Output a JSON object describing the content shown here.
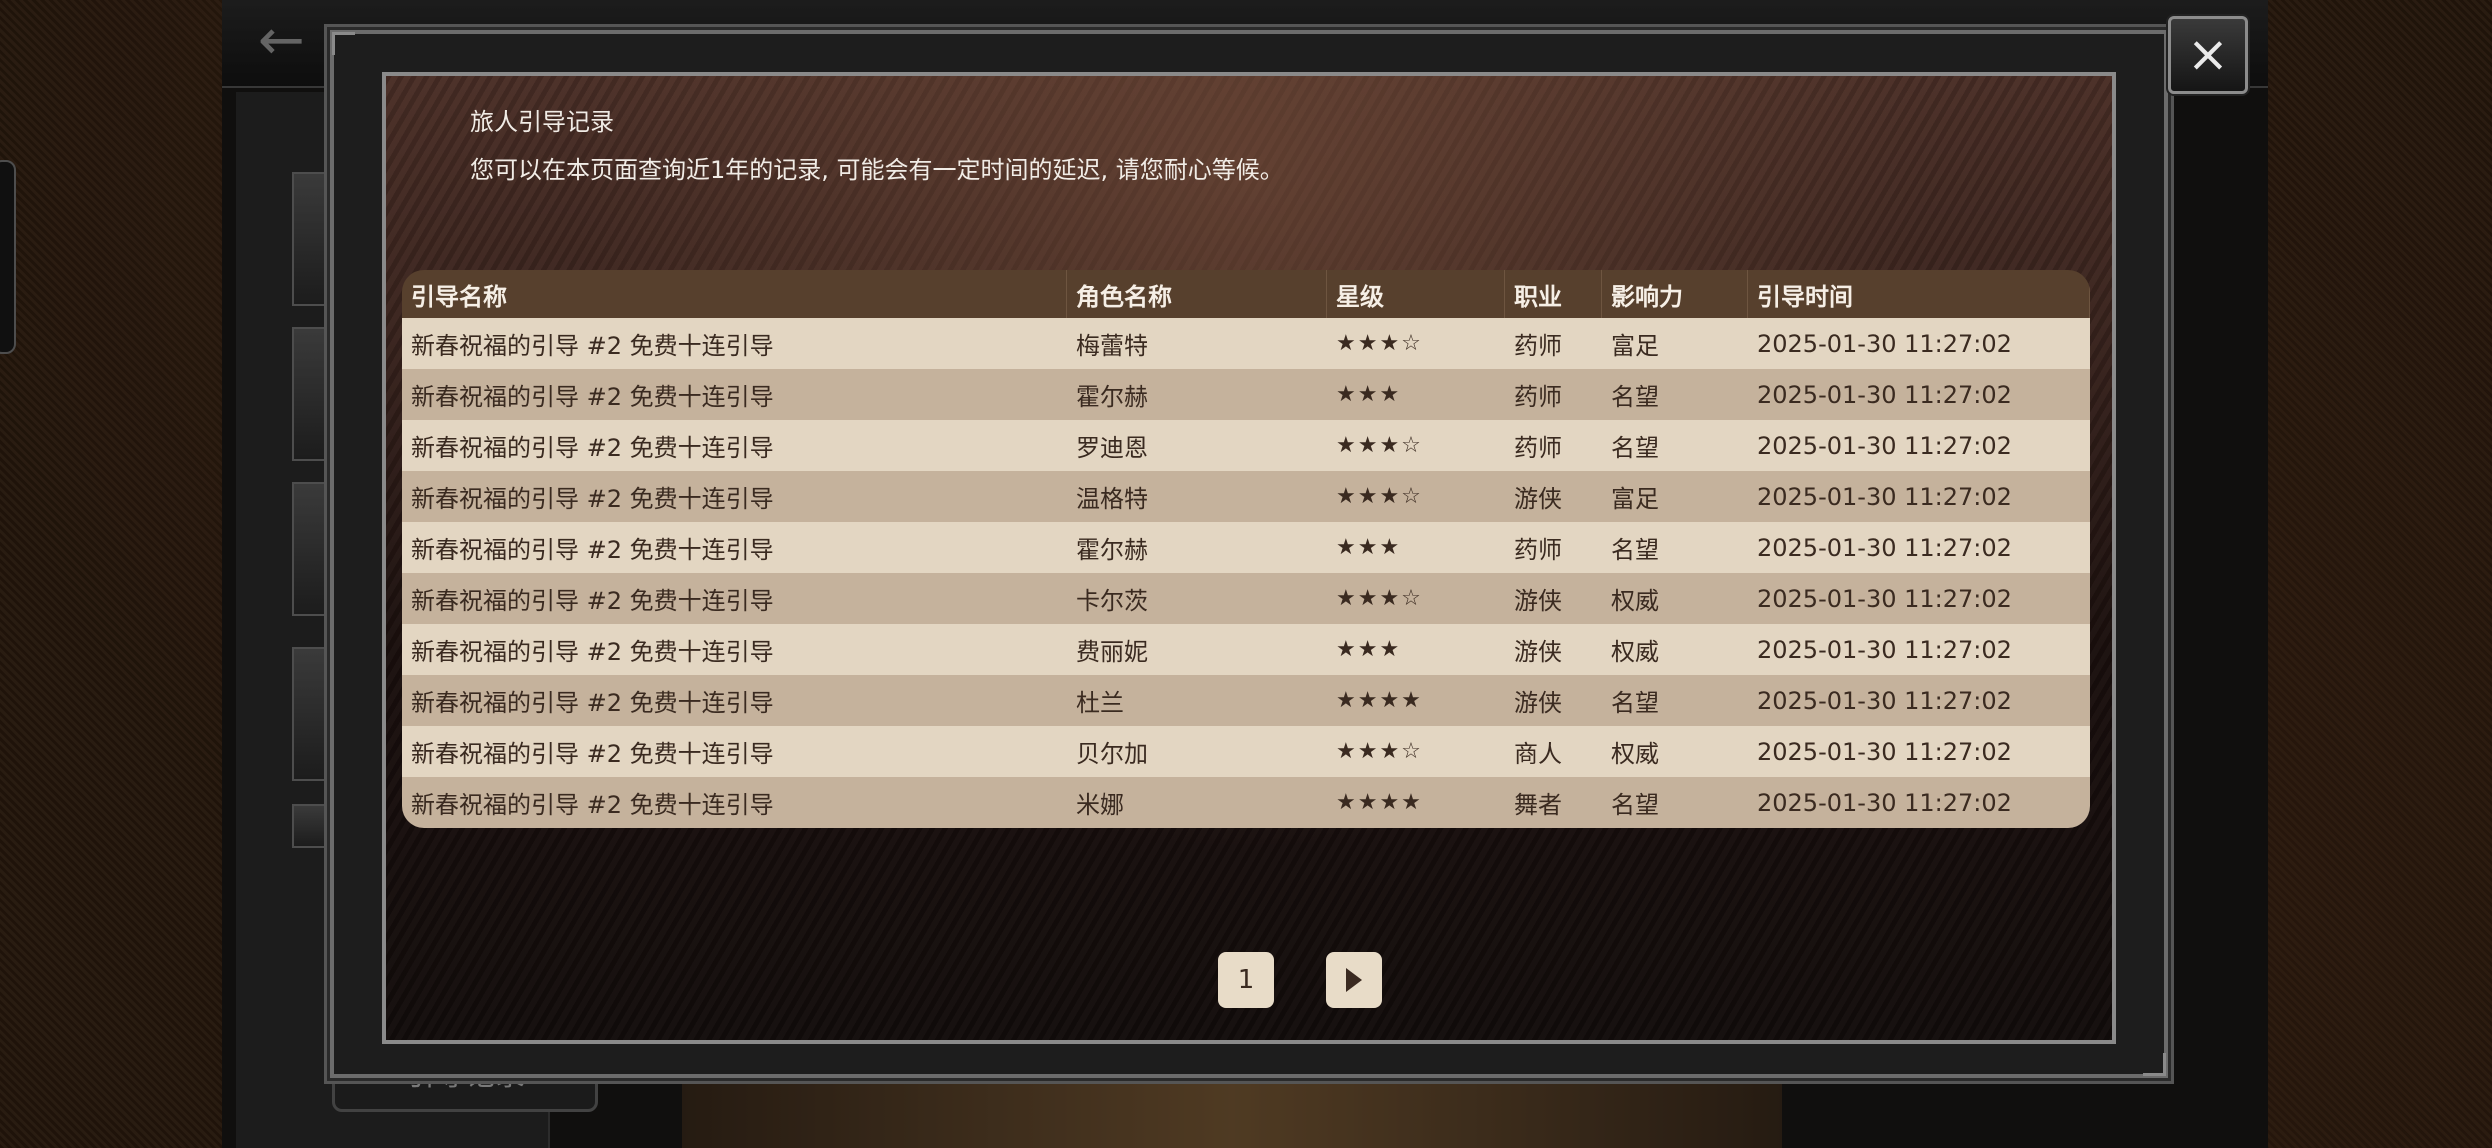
{
  "modal": {
    "title": "旅人引导记录",
    "subtitle": "您可以在本页面查询近1年的记录, 可能会有一定时间的延迟, 请您耐心等候。",
    "close_icon": "×"
  },
  "table": {
    "headers": [
      "引导名称",
      "角色名称",
      "星级",
      "职业",
      "影响力",
      "引导时间"
    ],
    "rows": [
      {
        "guide": "新春祝福的引导 #2 免费十连引导",
        "character": "梅蕾特",
        "stars": "★★★☆",
        "job": "药师",
        "influence": "富足",
        "time": "2025-01-30 11:27:02"
      },
      {
        "guide": "新春祝福的引导 #2 免费十连引导",
        "character": "霍尔赫",
        "stars": "★★★",
        "job": "药师",
        "influence": "名望",
        "time": "2025-01-30 11:27:02"
      },
      {
        "guide": "新春祝福的引导 #2 免费十连引导",
        "character": "罗迪恩",
        "stars": "★★★☆",
        "job": "药师",
        "influence": "名望",
        "time": "2025-01-30 11:27:02"
      },
      {
        "guide": "新春祝福的引导 #2 免费十连引导",
        "character": "温格特",
        "stars": "★★★☆",
        "job": "游侠",
        "influence": "富足",
        "time": "2025-01-30 11:27:02"
      },
      {
        "guide": "新春祝福的引导 #2 免费十连引导",
        "character": "霍尔赫",
        "stars": "★★★",
        "job": "药师",
        "influence": "名望",
        "time": "2025-01-30 11:27:02"
      },
      {
        "guide": "新春祝福的引导 #2 免费十连引导",
        "character": "卡尔茨",
        "stars": "★★★☆",
        "job": "游侠",
        "influence": "权威",
        "time": "2025-01-30 11:27:02"
      },
      {
        "guide": "新春祝福的引导 #2 免费十连引导",
        "character": "费丽妮",
        "stars": "★★★",
        "job": "游侠",
        "influence": "权威",
        "time": "2025-01-30 11:27:02"
      },
      {
        "guide": "新春祝福的引导 #2 免费十连引导",
        "character": "杜兰",
        "stars": "★★★★",
        "job": "游侠",
        "influence": "名望",
        "time": "2025-01-30 11:27:02"
      },
      {
        "guide": "新春祝福的引导 #2 免费十连引导",
        "character": "贝尔加",
        "stars": "★★★☆",
        "job": "商人",
        "influence": "权威",
        "time": "2025-01-30 11:27:02"
      },
      {
        "guide": "新春祝福的引导 #2 免费十连引导",
        "character": "米娜",
        "stars": "★★★★",
        "job": "舞者",
        "influence": "名望",
        "time": "2025-01-30 11:27:02"
      }
    ]
  },
  "pagination": {
    "current_page": "1",
    "next_icon": "play-right-icon"
  },
  "background": {
    "back_icon": "arrow-left-icon",
    "bottom_button_label": "引导记录"
  },
  "colors": {
    "header_bg": "#57402d",
    "row_light": "#e3d6c2",
    "row_dark": "#c5b29c",
    "text_light": "#f1ece6"
  }
}
